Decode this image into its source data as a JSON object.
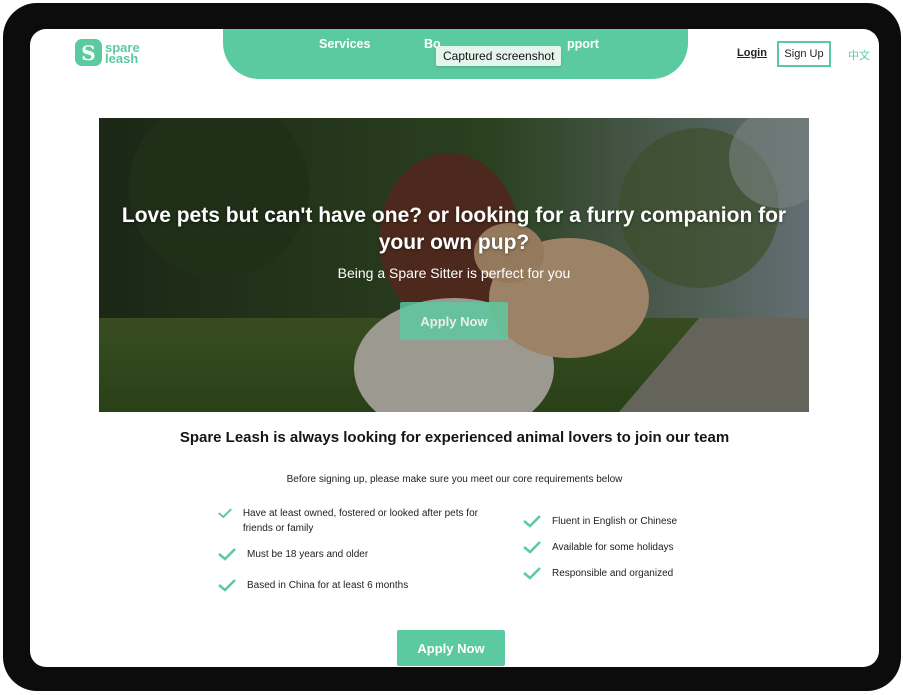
{
  "brand": {
    "logo_mark": "S",
    "line1": "spare",
    "line2": "leash",
    "accent": "#5ccaa1"
  },
  "nav": {
    "links": [
      "Services",
      "Bo",
      "pport"
    ],
    "tooltip": "Captured screenshot",
    "login": "Login",
    "signup": "Sign Up",
    "language": "中文"
  },
  "hero": {
    "title": "Love pets but can't have one? or looking for a furry companion for your own pup?",
    "subtitle": "Being a Spare Sitter is perfect for you",
    "cta": "Apply Now"
  },
  "main": {
    "headline": "Spare Leash is always looking for experienced animal lovers to join our team",
    "intro": "Before signing up, please make sure you meet our core requirements below",
    "requirements_left": [
      "Have at least owned, fostered or looked after pets for friends or family",
      "Must be 18 years and older",
      "Based in China for at least 6 months"
    ],
    "requirements_right": [
      "Fluent in English or Chinese",
      "Available for some holidays",
      "Responsible and organized"
    ],
    "cta": "Apply Now"
  }
}
